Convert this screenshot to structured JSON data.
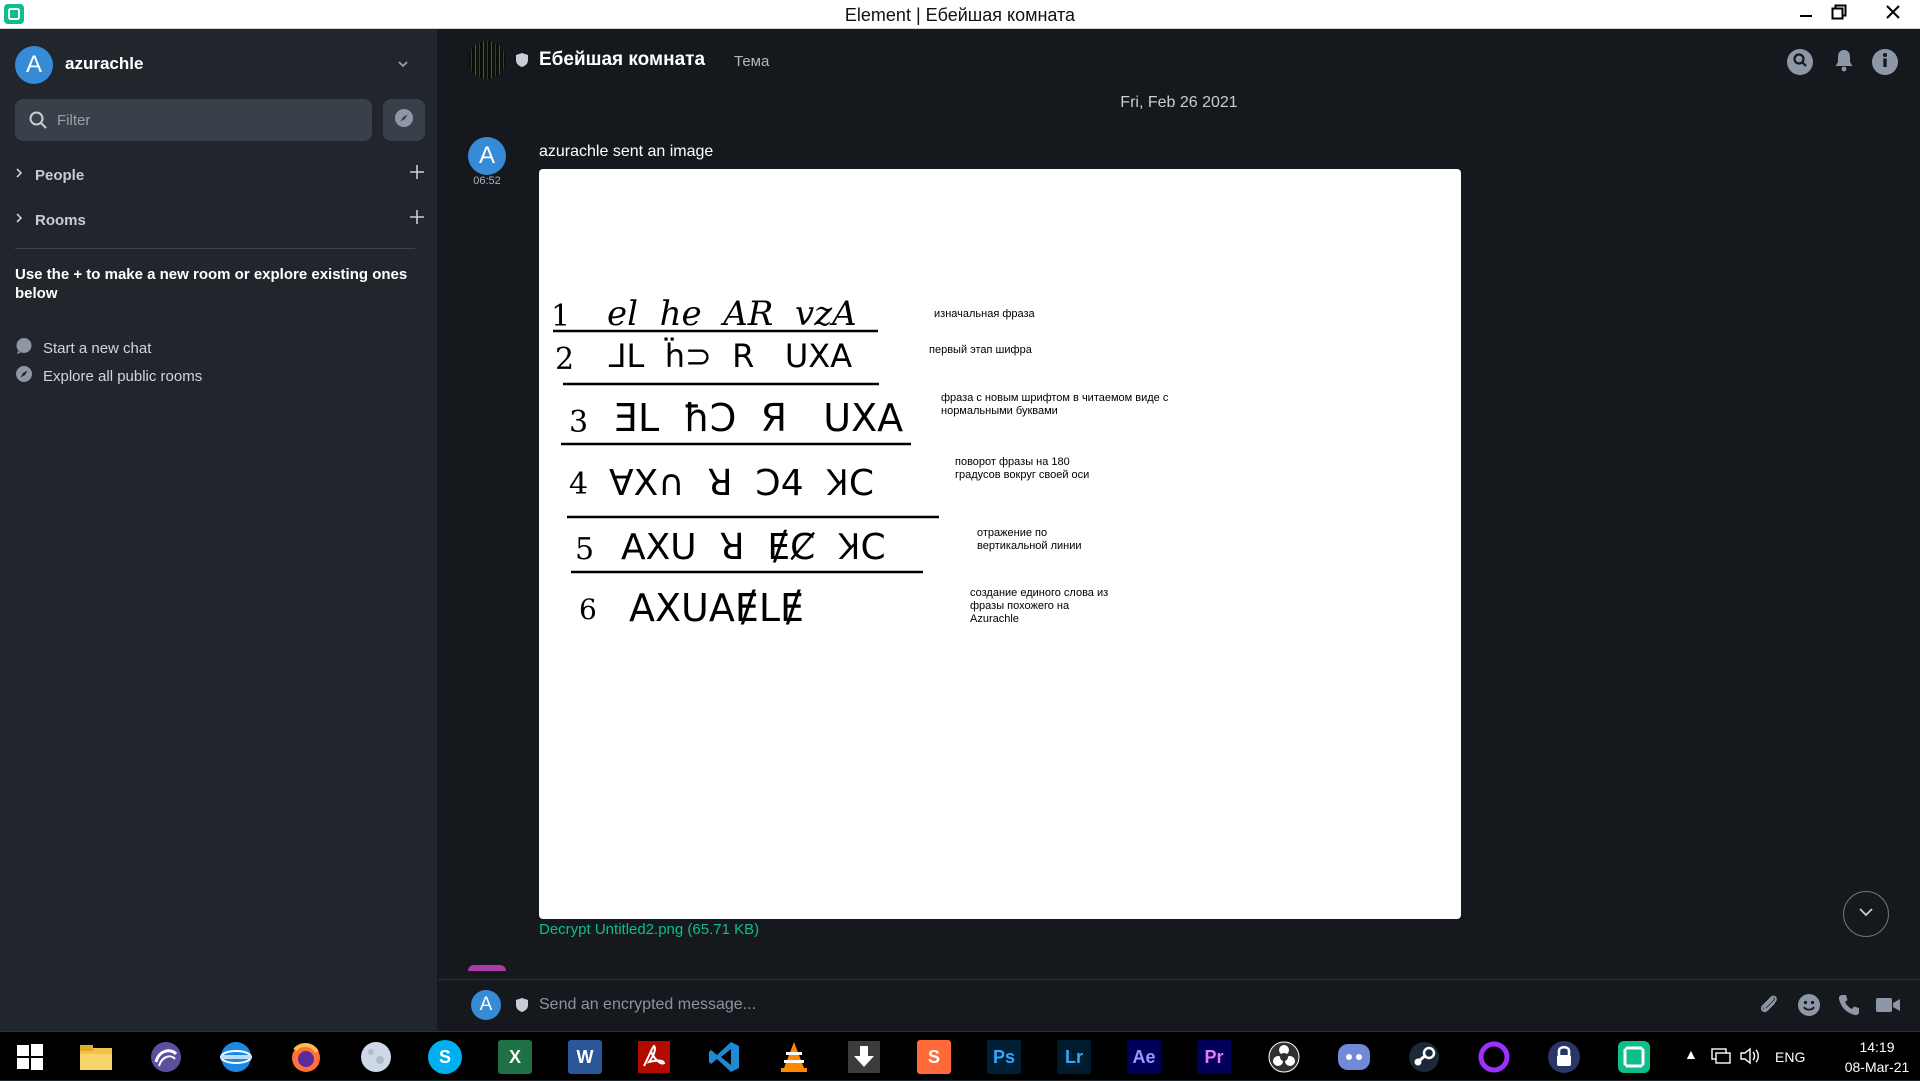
{
  "window": {
    "title": "Element | Ебейшая комната",
    "minimize_icon": "minimize-icon",
    "maximize_icon": "restore-icon",
    "close_icon": "close-icon"
  },
  "colors": {
    "accent": "#0dbd8b",
    "avatar_blue": "#368bd6",
    "sidebar_bg": "#21262c",
    "timeline_bg": "#15191e"
  },
  "sidebar": {
    "user": {
      "avatar_letter": "A",
      "name": "azurachle"
    },
    "filter": {
      "placeholder": "Filter"
    },
    "sections": [
      {
        "label": "People"
      },
      {
        "label": "Rooms"
      }
    ],
    "hint": "Use the + to make a new room or explore existing ones below",
    "links": [
      {
        "label": "Start a new chat",
        "icon": "chat-bubble-icon"
      },
      {
        "label": "Explore all public rooms",
        "icon": "compass-icon"
      }
    ]
  },
  "room": {
    "name": "Ебейшая комната",
    "topic": "Тема"
  },
  "timeline": {
    "date_separator": "Fri, Feb 26 2021",
    "message": {
      "avatar_letter": "A",
      "time": "06:52",
      "text": "azurachle sent an image",
      "attachment_link": "Decrypt Untitled2.png (65.71 KB)",
      "image": {
        "rows": [
          {
            "num": "1",
            "glyphs": "el  he  AR  vzA",
            "note": "изначальная фраза"
          },
          {
            "num": "2",
            "glyphs": "ᒧᒪ  ḧ⊃  R   UXA",
            "note": "первый этап шифра"
          },
          {
            "num": "3",
            "glyphs": "ƎL  ħƆ  Я   UXA",
            "note": "фраза с новым шрифтом в читаемом виде с нормальными буквами"
          },
          {
            "num": "4",
            "glyphs": "ⱯX∩  ꓤ  Ɔ4  ꞰC",
            "note": "поворот фразы на 180 градусов вокруг своей оси"
          },
          {
            "num": "5",
            "glyphs": "AXU  ꓤ  ɆȻ  ꞰC",
            "note": "отражение по вертикальной линии"
          },
          {
            "num": "6",
            "glyphs": "AXUAɆLɆ",
            "note": "создание единого слова из фразы похожего на Azurachle"
          }
        ]
      }
    }
  },
  "composer": {
    "avatar_letter": "A",
    "placeholder": "Send an encrypted message..."
  },
  "taskbar": {
    "apps": [
      {
        "name": "windows-start-icon"
      },
      {
        "name": "file-explorer-icon"
      },
      {
        "name": "torrent-client-icon"
      },
      {
        "name": "browser-globe-icon"
      },
      {
        "name": "firefox-icon"
      },
      {
        "name": "moon-app-icon"
      },
      {
        "name": "skype-icon",
        "label": "S"
      },
      {
        "name": "excel-icon",
        "label": "X"
      },
      {
        "name": "word-icon",
        "label": "W"
      },
      {
        "name": "acrobat-icon"
      },
      {
        "name": "vscode-icon"
      },
      {
        "name": "vlc-icon"
      },
      {
        "name": "downloader-icon"
      },
      {
        "name": "sublime-text-icon",
        "label": "S"
      },
      {
        "name": "photoshop-icon",
        "label": "Ps"
      },
      {
        "name": "lightroom-icon",
        "label": "Lr"
      },
      {
        "name": "after-effects-icon",
        "label": "Ae"
      },
      {
        "name": "premiere-icon",
        "label": "Pr"
      },
      {
        "name": "obs-icon"
      },
      {
        "name": "discord-icon"
      },
      {
        "name": "steam-icon"
      },
      {
        "name": "ring-app-icon"
      },
      {
        "name": "vpn-lock-icon"
      },
      {
        "name": "element-icon"
      }
    ],
    "tray": {
      "language": "ENG",
      "time": "14:19",
      "date": "08-Mar-21"
    }
  }
}
